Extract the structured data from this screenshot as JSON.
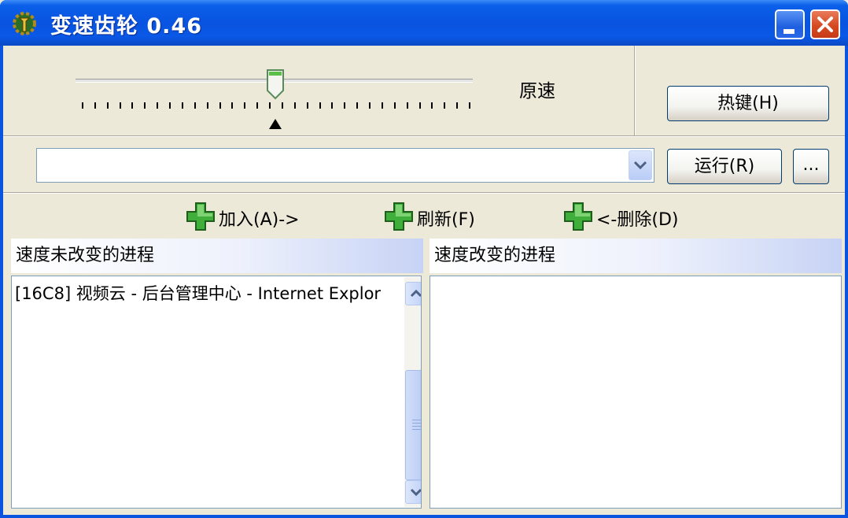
{
  "window": {
    "title": "变速齿轮 0.46",
    "colors": {
      "titlebar": "#0954e1",
      "close": "#d64a22",
      "face": "#ece9d8"
    }
  },
  "icons": {
    "app": "gear-app-icon",
    "minimize": "minimize-icon",
    "close": "close-icon",
    "plus": "green-plus-icon"
  },
  "speed": {
    "label": "原速",
    "slider_fraction": 0.5
  },
  "buttons": {
    "hotkey": "热键(H)",
    "run": "运行(R)",
    "browse": "..."
  },
  "process_combo": {
    "value": ""
  },
  "actions": {
    "add": "加入(A)->",
    "refresh": "刷新(F)",
    "remove": "<-删除(D)"
  },
  "lists": {
    "unchanged_header": "速度未改变的进程",
    "changed_header": "速度改变的进程",
    "unchanged_items": [
      "[16C8]  视频云 - 后台管理中心 - Internet Explor"
    ],
    "changed_items": []
  }
}
